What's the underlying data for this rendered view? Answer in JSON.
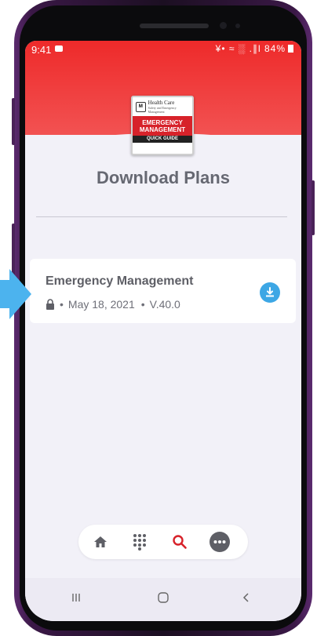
{
  "status_bar": {
    "time": "9:41",
    "right_icons": "¥• ≈ ░ .∥l",
    "battery": "84%"
  },
  "logo": {
    "org_name": "Health Care",
    "org_subtitle": "Safety and Emergency Management",
    "title_line1": "EMERGENCY",
    "title_line2": "MANAGEMENT",
    "footer": "QUICK GUIDE"
  },
  "page": {
    "title": "Download Plans"
  },
  "plans": [
    {
      "name": "Emergency Management",
      "date": "May 18, 2021",
      "version": "V.40.0",
      "icon": "lock-icon",
      "action_icon": "download-icon"
    }
  ],
  "separator": "•",
  "tab_bar": [
    {
      "icon": "home-icon",
      "active": false
    },
    {
      "icon": "keypad-icon",
      "active": false
    },
    {
      "icon": "search-icon",
      "active": true
    },
    {
      "icon": "more-icon",
      "active": false
    }
  ],
  "nav_bar": [
    "recent-apps-icon",
    "home-button-icon",
    "back-icon"
  ],
  "colors": {
    "header": "#ee2a2a",
    "accent": "#d7222a",
    "download": "#3da7e5",
    "pointer_arrow": "#4cb3ee"
  }
}
